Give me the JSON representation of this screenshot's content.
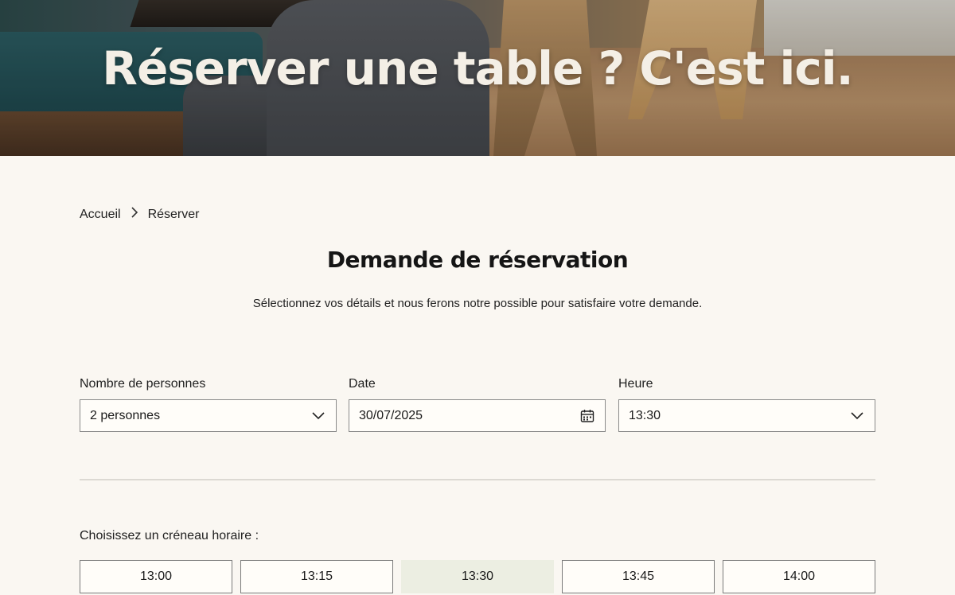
{
  "hero": {
    "title": "Réserver une table ? C'est ici."
  },
  "breadcrumb": {
    "home": "Accueil",
    "current": "Réserver"
  },
  "page": {
    "title": "Demande de réservation",
    "subtitle": "Sélectionnez vos détails et nous ferons notre possible pour satisfaire votre demande."
  },
  "form": {
    "persons": {
      "label": "Nombre de personnes",
      "value": "2 personnes",
      "icon": "chevron-down-icon"
    },
    "date": {
      "label": "Date",
      "value": "30/07/2025",
      "icon": "calendar-icon"
    },
    "time": {
      "label": "Heure",
      "value": "13:30",
      "icon": "chevron-down-icon"
    }
  },
  "slots": {
    "label": "Choisissez un créneau horaire :",
    "items": [
      "13:00",
      "13:15",
      "13:30",
      "13:45",
      "14:00"
    ],
    "selected": "13:30"
  }
}
